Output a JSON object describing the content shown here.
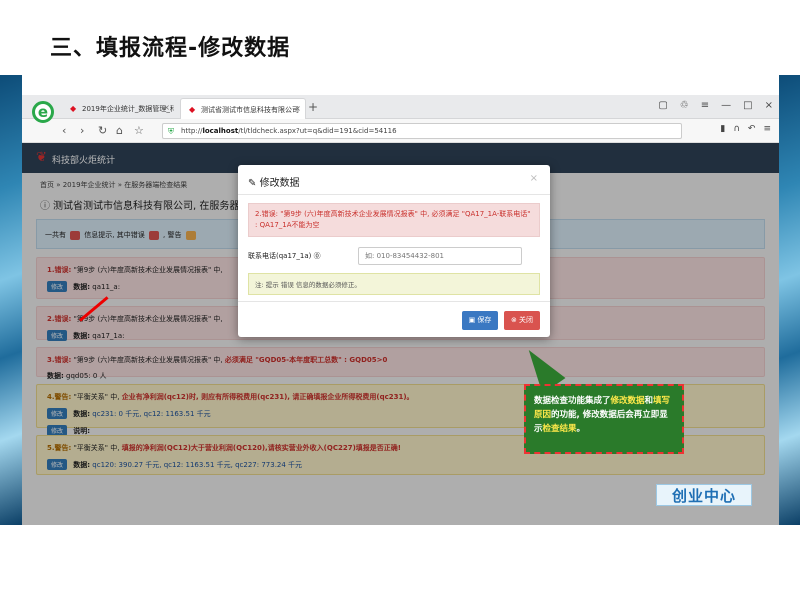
{
  "slide": {
    "title": "三、填报流程-修改数据"
  },
  "browser": {
    "tab1": "2019年企业统计_数据管理_科技",
    "tab2": "测试省测试市信息科技有限公司",
    "url_prefix": "http://",
    "url_host": "localhost",
    "url_path": "/tl/tldcheck.aspx?ut=q&did=191&cid=54116"
  },
  "site": {
    "brand": "科技部火炬统计",
    "breadcrumb": "首页 » 2019年企业统计 » 在服务器端检查结果",
    "org_title": "测试省测试市信息科技有限公司, 在服务器端",
    "summary": {
      "prefix": "一共有",
      "mid": "信息提示, 其中错误",
      "tail": ", 警告"
    },
    "items": [
      {
        "label": "1.错误:",
        "desc": "\"第9步 (六)年度高新技术企业发展情况报表\" 中,",
        "data_label": "数据:",
        "data": "qa11_a:"
      },
      {
        "label": "2.错误:",
        "desc": "\"第9步 (六)年度高新技术企业发展情况报表\" 中,",
        "data_label": "数据:",
        "data": "qa17_1a:"
      },
      {
        "label": "3.错误:",
        "desc": "\"第9步 (六)年度高新技术企业发展情况报表\" 中,",
        "cond": "必须满足 \"GQD05-本年度职工总数\" : GQD05>0",
        "data_label": "数据:",
        "data": "gqd05: 0 人"
      },
      {
        "label": "4.警告:",
        "desc": "\"平衡关系\" 中,",
        "cond": "企业有净利润(qc12)时, 则应有所得税费用(qc231), 请正确填报企业所得税费用(qc231)。",
        "data_label": "数据:",
        "data": "qc231: 0 千元,  qc12: 1163.51 千元",
        "explain": "说明:"
      },
      {
        "label": "5.警告:",
        "desc": "\"平衡关系\" 中,",
        "cond": "填报的净利润(QC12)大于营业利润(QC120),请核实营业外收入(QC227)填报是否正确!",
        "data_label": "数据:",
        "data": "qc120: 390.27 千元,  qc12: 1163.51 千元,  qc227: 773.24 千元"
      }
    ],
    "edit_btn": "修改"
  },
  "modal": {
    "title": "修改数据",
    "error": "2.错误: \"第9步 (六)年度高新技术企业发展情况报表\" 中, 必须满足 \"QA17_1A-联系电话\" : QA17_1A不能为空",
    "field_label": "联系电话(qa17_1a)",
    "field_placeholder": "如: 010-83454432-801",
    "note": "注: 提示 错误 信息的数据必须修正。",
    "save": "保存",
    "close": "关闭"
  },
  "callout": {
    "part1": "数据检查功能集成了",
    "hl1": "修改数据",
    "part2": "和",
    "hl2": "填写原因",
    "part3": "的功能, 修改数据后会再立即显示",
    "hl3": "检查结果",
    "part4": "。"
  },
  "brand_badge": "创业中心"
}
